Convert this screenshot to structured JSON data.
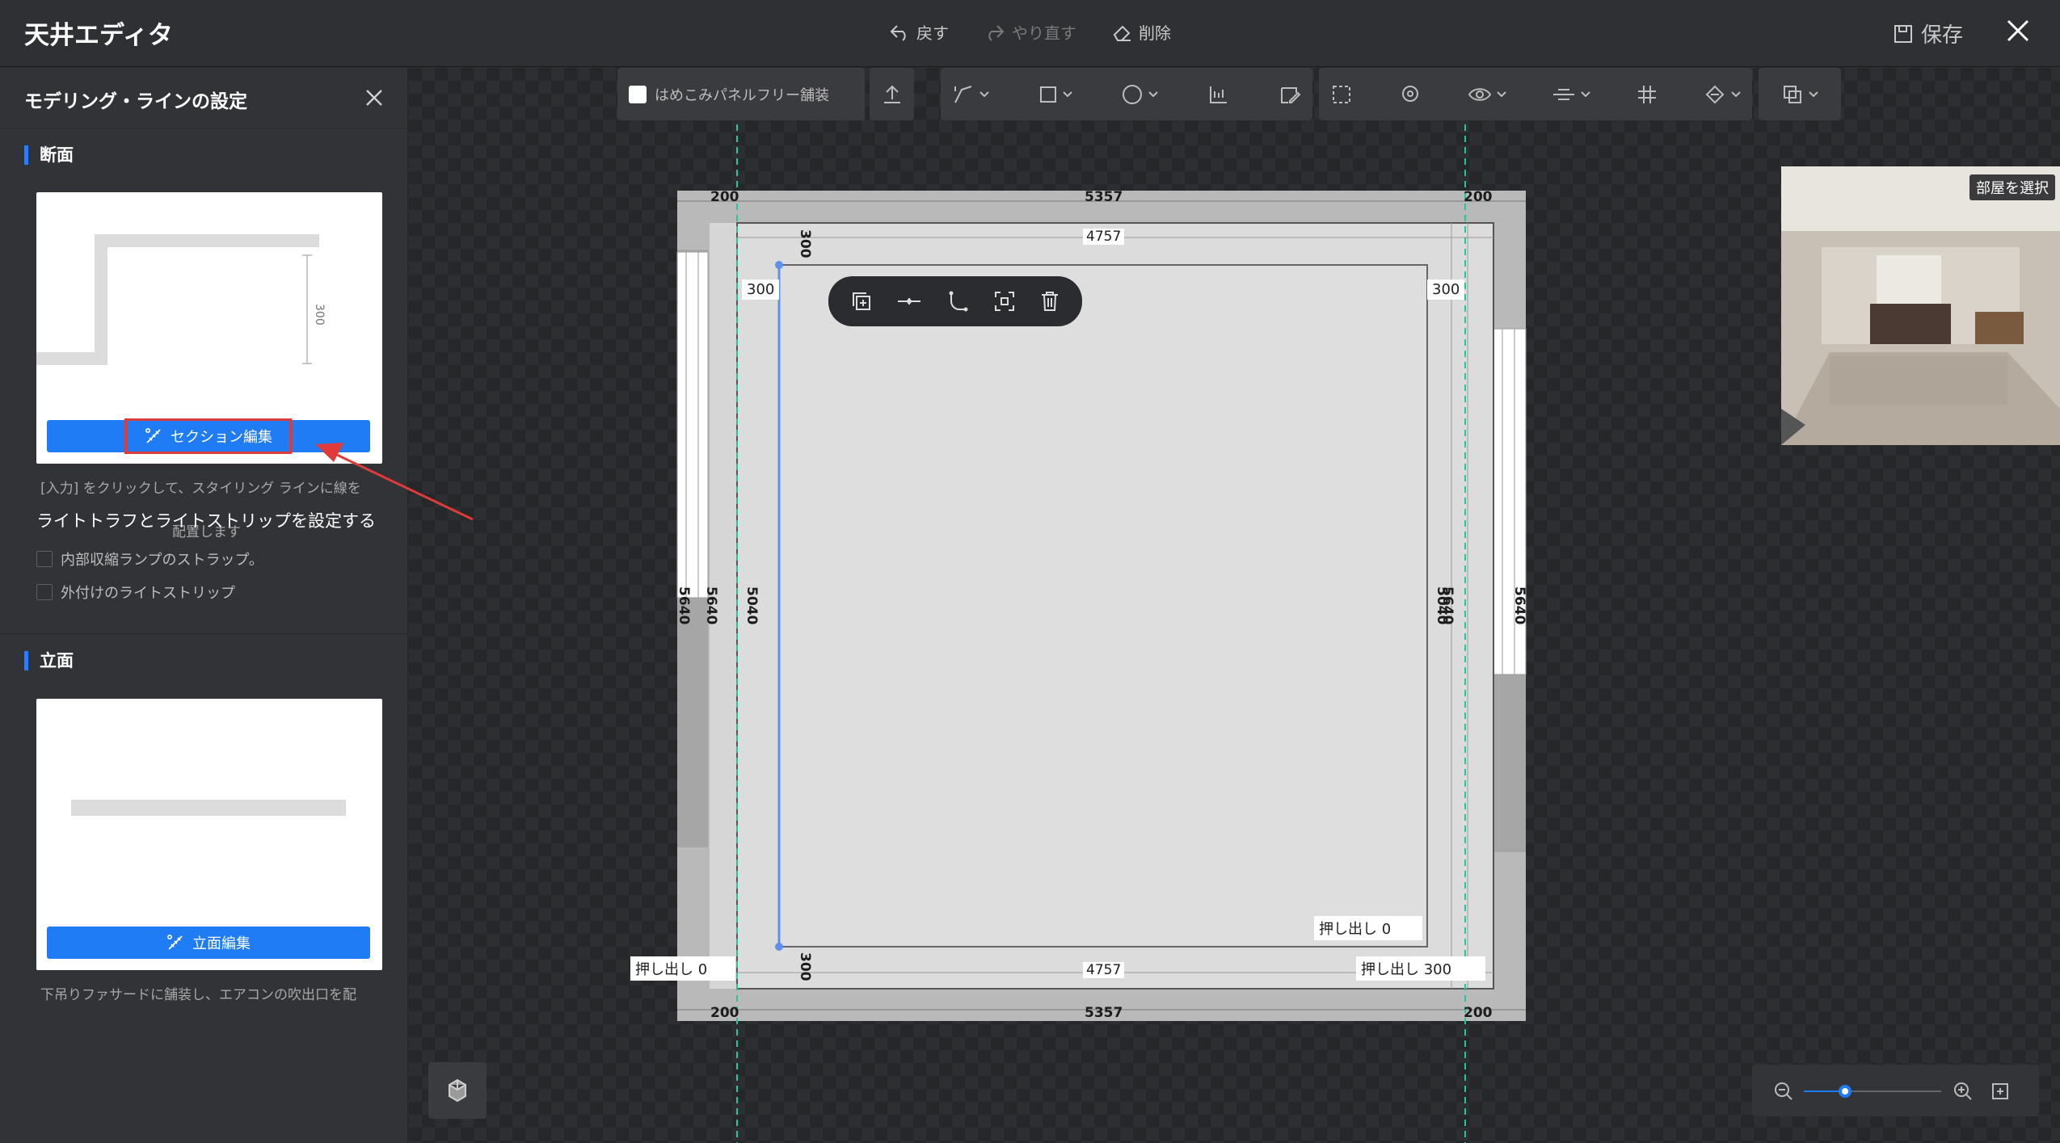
{
  "app": {
    "title": "天井エディタ"
  },
  "topbar": {
    "undo": "戻す",
    "redo": "やり直す",
    "delete": "削除",
    "save": "保存"
  },
  "sidebar": {
    "title": "モデリング・ラインの設定",
    "section1": "断面",
    "section_card": {
      "dim_label": "300",
      "button": "セクション編集"
    },
    "hint1_line1": "[入力] をクリックして、スタイリング ラインに線を",
    "overlay_heading": "ライトトラフとライトストリップを設定する",
    "hint1_line2": "配置します",
    "options": [
      "内部収縮ランプのストラップ。",
      "外付けのライトストリップ"
    ],
    "section2": "立面",
    "elevation_card": {
      "button": "立面編集"
    },
    "hint2": "下吊りファサードに舗装し、エアコンの吹出口を配"
  },
  "toolbar": {
    "panel_free": "はめこみパネルフリー舗装"
  },
  "plan": {
    "dims": {
      "outer_left": "200",
      "outer_mid": "5357",
      "outer_right": "200",
      "inner_top": "4757",
      "inner_bottom": "4757",
      "offset_top": "300",
      "offset_bottom": "300",
      "side_left": "300",
      "side_right": "300",
      "outer_bottom_left": "200",
      "outer_bottom_mid": "5357",
      "outer_bottom_right": "200",
      "v_left_outer": "5640",
      "v_left_mid": "5640",
      "v_left_inner": "5040",
      "v_right_inner": "5040",
      "v_right_inner2": "5640",
      "v_right_outer": "5640"
    },
    "extrude_label": "押し出し",
    "extrude_inner": "0",
    "extrude_left": "0",
    "extrude_right": "300"
  },
  "preview": {
    "label": "部屋を選択"
  },
  "zoom": {
    "level": 0.3
  },
  "colors": {
    "accent": "#1f7cf5",
    "guide": "#1fc6a0",
    "highlight": "#e03b3b"
  }
}
